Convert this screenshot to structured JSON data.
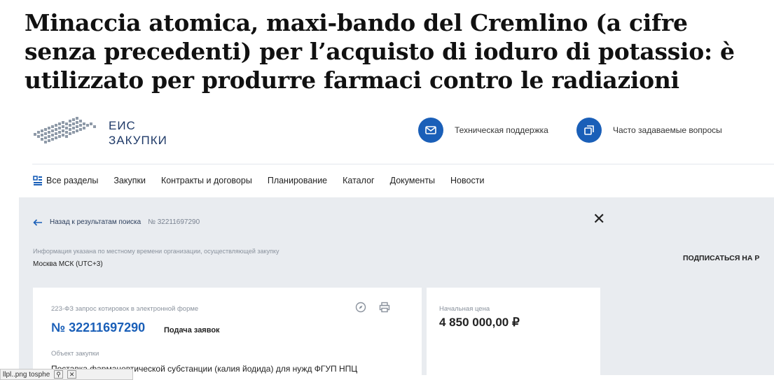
{
  "article": {
    "headline": "Minaccia atomica, maxi-bando del Cremlino (a cifre senza precedenti) per l’acquisto di ioduro di potassio: è utilizzato per produrre farmaci contro le radiazioni"
  },
  "site": {
    "logo_line1": "ЕИС",
    "logo_line2": "ЗАКУПКИ",
    "support_label": "Техническая поддержка",
    "faq_label": "Часто задаваемые вопросы",
    "accent_color": "#1a5fb8"
  },
  "nav": {
    "items": [
      {
        "label": "Все разделы"
      },
      {
        "label": "Закупки"
      },
      {
        "label": "Контракты и договоры"
      },
      {
        "label": "Планирование"
      },
      {
        "label": "Каталог"
      },
      {
        "label": "Документы"
      },
      {
        "label": "Новости"
      }
    ]
  },
  "page": {
    "back_label": "Назад к результатам поиска",
    "record_ref": "№ 32211697290",
    "tz_note": "Информация указана по местному времени организации, осуществляющей закупку",
    "tz_value": "Москва МСК (UTC+3)",
    "subscribe_label": "ПОДПИСАТЬСЯ НА Р"
  },
  "card": {
    "type": "223-ФЗ запрос котировок в электронной форме",
    "number": "№ 32211697290",
    "status": "Подача заявок",
    "object_label": "Объект закупки",
    "object_value": "Поставка фармацевтической субстанции (калия йодида) для нужд ФГУП НПЦ",
    "price_label": "Начальная цена",
    "price_value": "4 850 000,00 ₽"
  },
  "statusbar": {
    "text": "llpl..png  tosphe"
  }
}
